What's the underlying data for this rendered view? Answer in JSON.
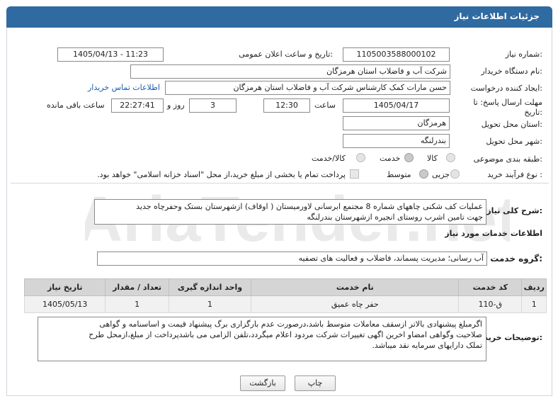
{
  "header": {
    "title": "جزئیات اطلاعات نیاز"
  },
  "fields": {
    "need_number_label": "شماره نیاز:",
    "need_number": "1105003588000102",
    "announce_label": "تاریخ و ساعت اعلان عمومی:",
    "announce_value": "1405/04/13 - 11:23",
    "buyer_label": "نام دستگاه خریدار:",
    "buyer_value": "شرکت آب و فاضلاب استان هرمزگان",
    "creator_label": "ایجاد کننده درخواست:",
    "creator_value": "حسن مارات کمک کارشناس شرکت آب و فاضلاب استان هرمزگان",
    "contact_link": "اطلاعات تماس خریدار",
    "deadline_label_1": "مهلت ارسال پاسخ: تا",
    "deadline_label_2": "تاریخ:",
    "deadline_date": "1405/04/17",
    "time_label": "ساعت",
    "deadline_time": "12:30",
    "days_value": "3",
    "days_label": "روز و",
    "remaining_time": "22:27:41",
    "remaining_label": "ساعت باقی مانده",
    "province_label": "استان محل تحویل:",
    "province_value": "هرمزگان",
    "city_label": "شهر محل تحویل:",
    "city_value": "بندرلنگه",
    "category_label": "طبقه بندی موضوعی:",
    "category_options": [
      "کالا",
      "خدمت",
      "کالا/خدمت"
    ],
    "process_label": "نوع فرآیند خرید :",
    "process_options": [
      "جزیی",
      "متوسط"
    ],
    "payment_note": "پرداخت تمام یا بخشی از مبلغ خرید،از محل \"اسناد خزانه اسلامی\" خواهد بود."
  },
  "description": {
    "label": "شرح کلی نیاز:",
    "text_line1": "عملیات کف شکنی چاههای شماره 8 مجتمع ابرسانی لاورمیستان ( اوقاف) ازشهرستان بستک وحفرچاه جدید",
    "text_line2": "جهت تامین اشرب روستای انجیره ازشهرستان بندرلنگه"
  },
  "services": {
    "section_title": "اطلاعات خدمات مورد نیاز",
    "group_label": "گروه خدمت:",
    "group_value": "آب رسانی؛ مدیریت پسماند، فاضلاب و فعالیت های تصفیه",
    "columns": [
      "ردیف",
      "کد خدمت",
      "نام خدمت",
      "واحد اندازه گیری",
      "تعداد / مقدار",
      "تاریخ نیاز"
    ],
    "rows": [
      {
        "row": "1",
        "code": "ق-110",
        "name": "حفر چاه عمیق",
        "unit": "1",
        "qty": "1",
        "date": "1405/05/13"
      }
    ]
  },
  "buyer_notes": {
    "label": "توضیحات خریدار:",
    "line1": "اگرمبلغ پیشنهادی بالاتر ازسقف معاملات متوسط باشد،درصورت عدم بارگزاری برگ پیشنهاد قیمت و اساسنامه و گواهی",
    "line2": "صلاحیت وگواهی امضاو اخرین اگهی تغییرات شرکت مردود اعلام میگردد،تلفن الزامی می باشدپرداخت از مبلغ،ازمحل طرح",
    "line3": "تملک دارایهای سرمایه نقد میباشد."
  },
  "buttons": {
    "print": "چاپ",
    "back": "بازگشت"
  },
  "watermark": "AriaTender.net"
}
